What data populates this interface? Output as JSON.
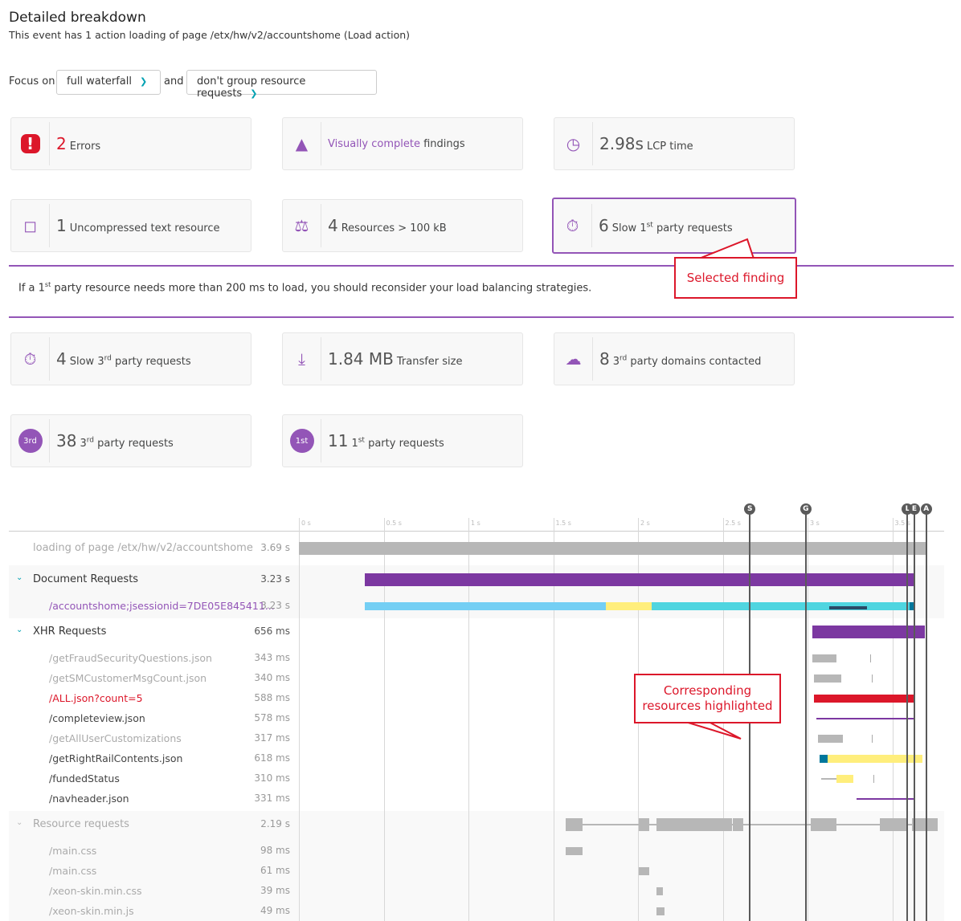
{
  "header": {
    "title": "Detailed breakdown",
    "subtitle": "This event has 1 action loading of page /etx/hw/v2/accountshome (Load action)"
  },
  "focus": {
    "label": "Focus on",
    "dropdown1": "full waterfall",
    "and": "and",
    "dropdown2": "don't group resource requests"
  },
  "tiles": [
    {
      "num": "2",
      "text": "Errors",
      "icon": "error-icon"
    },
    {
      "link": "Visually complete",
      "text": "findings",
      "icon": "turtle-icon"
    },
    {
      "num": "2.98s",
      "text": "LCP time",
      "icon": "gauge-icon"
    },
    {
      "num": "1",
      "text": "Uncompressed text resource",
      "icon": "document-icon"
    },
    {
      "num": "4",
      "text": "Resources > 100 kB",
      "icon": "scale-icon"
    },
    {
      "num": "6",
      "pre": "Slow 1",
      "sup": "st",
      "text": "party requests",
      "icon": "stopwatch-icon",
      "selected": true
    },
    {
      "num": "4",
      "pre": "Slow 3",
      "sup": "rd",
      "text": "party requests",
      "icon": "stopwatch-icon"
    },
    {
      "num": "1.84 MB",
      "text": "Transfer size",
      "icon": "download-icon"
    },
    {
      "num": "8",
      "pre": "3",
      "sup": "rd",
      "text": "party domains contacted",
      "icon": "cloud-icon"
    },
    {
      "num": "38",
      "pre": "3",
      "sup": "rd",
      "text": "party requests",
      "badge": "3rd"
    },
    {
      "num": "11",
      "pre": "1",
      "sup": "st",
      "text": "party requests",
      "badge": "1st"
    }
  ],
  "info": {
    "a": "If a 1",
    "sup": "st",
    "b": " party resource needs more than 200 ms to load, you should reconsider your load balancing strategies."
  },
  "callouts": {
    "selected": "Selected finding",
    "highlight": "Corresponding resources highlighted"
  },
  "colors": {
    "accent": "#9355b7",
    "purple": "#7c38a1",
    "gray": "#b7b7b7",
    "red": "#dc172a",
    "yellow": "#ffee7c",
    "lightblue": "#74cff4",
    "cyan": "#4fd5e0",
    "blue": "#00779c",
    "navy": "#2a4a66"
  },
  "timeline": {
    "ticks": [
      "0 s",
      "0.5 s",
      "1 s",
      "1.5 s",
      "2 s",
      "2.5 s",
      "3 s",
      "3.5 s"
    ],
    "markers": [
      {
        "label": "S",
        "t": 2.66
      },
      {
        "label": "G",
        "t": 2.99
      },
      {
        "label": "L",
        "t": 3.59
      },
      {
        "label": "E",
        "t": 3.63
      },
      {
        "label": "A",
        "t": 3.7
      }
    ],
    "rows": [
      {
        "name": "loading of page /etx/hw/v2/accountshome",
        "dur": "3.69 s",
        "kind": "page",
        "bars": [
          [
            0,
            3.7,
            "gray"
          ]
        ]
      },
      {
        "name": "Document Requests",
        "dur": "3.23 s",
        "kind": "group",
        "bars": [
          [
            0.39,
            3.63,
            "purple"
          ]
        ]
      },
      {
        "name": "/accountshome;jsessionid=7DE05E845411...",
        "dur": "3.23 s",
        "kind": "doc",
        "bars": [
          [
            0.39,
            1.81,
            "lightblue"
          ],
          [
            1.81,
            2.08,
            "yellow"
          ],
          [
            2.08,
            3.6,
            "cyan"
          ],
          [
            3.6,
            3.63,
            "blue"
          ]
        ],
        "thin": [
          [
            3.13,
            3.35,
            "navy"
          ]
        ]
      },
      {
        "name": "XHR Requests",
        "dur": "656 ms",
        "kind": "group",
        "bars": [
          [
            3.03,
            3.69,
            "purple"
          ]
        ]
      },
      {
        "name": "/getFraudSecurityQuestions.json",
        "dur": "343 ms",
        "kind": "dim",
        "bars": [
          [
            3.03,
            3.17,
            "gray"
          ]
        ],
        "ticks": [
          3.37
        ]
      },
      {
        "name": "/getSMCustomerMsgCount.json",
        "dur": "340 ms",
        "kind": "dim",
        "bars": [
          [
            3.04,
            3.2,
            "gray"
          ]
        ],
        "ticks": [
          3.38
        ]
      },
      {
        "name": "/ALL.json?count=5",
        "dur": "588 ms",
        "kind": "err",
        "bars": [
          [
            3.04,
            3.63,
            "red"
          ]
        ]
      },
      {
        "name": "/completeview.json",
        "dur": "578 ms",
        "kind": "hl",
        "lines": [
          [
            3.05,
            3.63,
            "purple"
          ]
        ]
      },
      {
        "name": "/getAllUserCustomizations",
        "dur": "317 ms",
        "kind": "dim",
        "bars": [
          [
            3.06,
            3.21,
            "gray"
          ]
        ],
        "ticks": [
          3.38
        ]
      },
      {
        "name": "/getRightRailContents.json",
        "dur": "618 ms",
        "kind": "hl",
        "bars": [
          [
            3.07,
            3.12,
            "blue"
          ],
          [
            3.12,
            3.68,
            "yellow"
          ]
        ]
      },
      {
        "name": "/fundedStatus",
        "dur": "310 ms",
        "kind": "hl",
        "lines": [
          [
            3.08,
            3.17,
            "gray"
          ]
        ],
        "bars": [
          [
            3.17,
            3.27,
            "yellow"
          ]
        ],
        "ticks": [
          3.39
        ]
      },
      {
        "name": "/navheader.json",
        "dur": "331 ms",
        "kind": "hl",
        "lines": [
          [
            3.29,
            3.63,
            "purple"
          ]
        ]
      },
      {
        "name": "Resource requests",
        "dur": "2.19 s",
        "kind": "rgroup",
        "lines": [
          [
            1.573,
            3.76,
            "gray"
          ]
        ],
        "bars": [
          [
            1.573,
            1.673,
            "gray"
          ],
          [
            2.005,
            2.066,
            "gray"
          ],
          [
            2.109,
            2.555,
            "gray"
          ],
          [
            2.559,
            2.621,
            "gray"
          ],
          [
            3.018,
            3.17,
            "gray"
          ],
          [
            3.427,
            3.583,
            "gray"
          ],
          [
            3.616,
            3.768,
            "gray"
          ]
        ]
      },
      {
        "name": "/main.css",
        "dur": "98 ms",
        "kind": "res",
        "bars": [
          [
            1.573,
            1.673,
            "gray"
          ]
        ]
      },
      {
        "name": "/main.css",
        "dur": "61 ms",
        "kind": "res",
        "bars": [
          [
            2.005,
            2.066,
            "gray"
          ]
        ]
      },
      {
        "name": "/xeon-skin.min.css",
        "dur": "39 ms",
        "kind": "res",
        "bars": [
          [
            2.109,
            2.147,
            "gray"
          ]
        ]
      },
      {
        "name": "/xeon-skin.min.js",
        "dur": "49 ms",
        "kind": "res",
        "bars": [
          [
            2.109,
            2.156,
            "gray"
          ]
        ]
      }
    ]
  }
}
